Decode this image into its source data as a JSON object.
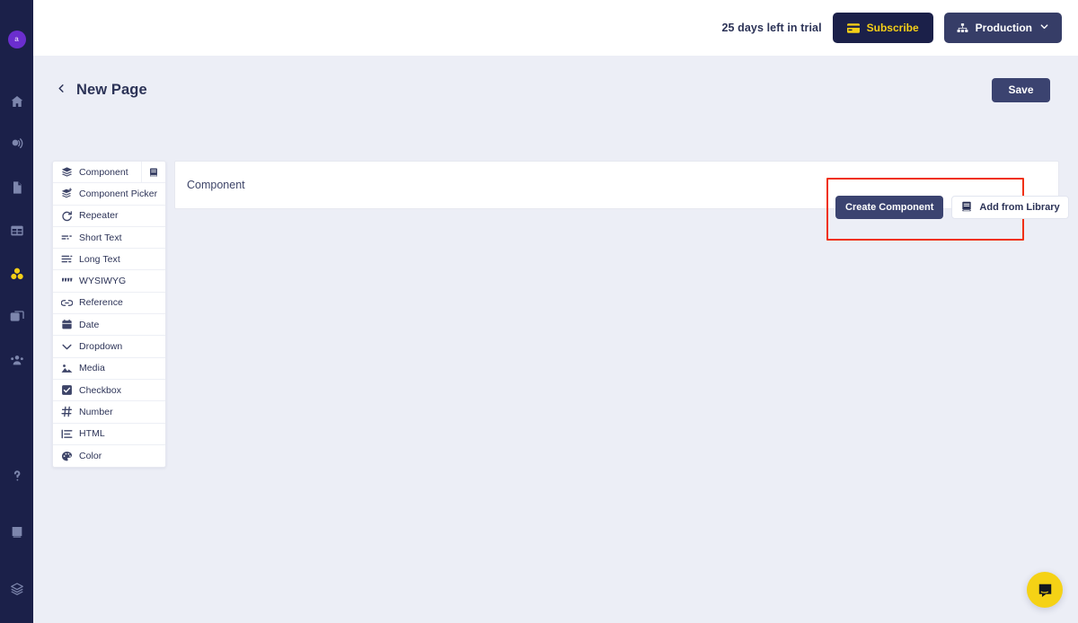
{
  "left_rail": {
    "avatar_initial": "a",
    "items": [
      {
        "name": "home",
        "icon": "home-icon",
        "active": false
      },
      {
        "name": "broadcast",
        "icon": "broadcast-icon",
        "active": false
      },
      {
        "name": "pages",
        "icon": "document-icon",
        "active": false
      },
      {
        "name": "collections",
        "icon": "table-icon",
        "active": false
      },
      {
        "name": "components",
        "icon": "components-icon",
        "active": true
      },
      {
        "name": "media",
        "icon": "media-icon",
        "active": false
      },
      {
        "name": "users",
        "icon": "users-icon",
        "active": false
      }
    ],
    "bottom_items": [
      {
        "name": "help",
        "icon": "question-mark-icon"
      },
      {
        "name": "docs",
        "icon": "book-icon"
      },
      {
        "name": "layers",
        "icon": "layers-icon"
      }
    ]
  },
  "topbar": {
    "trial_text": "25 days left in trial",
    "subscribe_label": "Subscribe",
    "environment_label": "Production"
  },
  "page_header": {
    "title": "New Page",
    "save_label": "Save"
  },
  "field_row": {
    "label": "Component",
    "create_component_label": "Create Component",
    "add_from_library_label": "Add from Library"
  },
  "type_dropdown": {
    "items": [
      {
        "label": "Component",
        "icon": "layers-stack-icon"
      },
      {
        "label": "Component Picker",
        "icon": "layers-plus-icon"
      },
      {
        "label": "Repeater",
        "icon": "refresh-icon"
      },
      {
        "label": "Short Text",
        "icon": "short-text-icon"
      },
      {
        "label": "Long Text",
        "icon": "long-text-icon"
      },
      {
        "label": "WYSIWYG",
        "icon": "quote-icon"
      },
      {
        "label": "Reference",
        "icon": "link-icon"
      },
      {
        "label": "Date",
        "icon": "calendar-icon"
      },
      {
        "label": "Dropdown",
        "icon": "chevron-down-icon"
      },
      {
        "label": "Media",
        "icon": "image-icon"
      },
      {
        "label": "Checkbox",
        "icon": "checkbox-icon"
      },
      {
        "label": "Number",
        "icon": "hash-icon"
      },
      {
        "label": "HTML",
        "icon": "list-icon"
      },
      {
        "label": "Color",
        "icon": "palette-icon"
      }
    ]
  },
  "chat": {
    "icon": "chat-bubble-icon"
  },
  "colors": {
    "rail_bg": "#1b2049",
    "page_bg": "#eceef6",
    "accent_yellow": "#f5cf17",
    "accent_purple": "#6b2ecf",
    "navy_button": "#3b4370",
    "highlight_red": "#f0300f",
    "trash_red": "#ef4a35"
  }
}
